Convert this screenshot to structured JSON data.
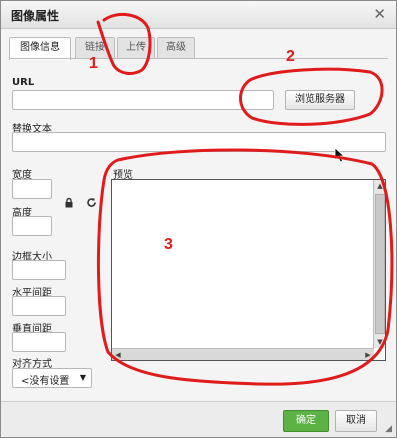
{
  "dialog": {
    "title": "图像属性",
    "close_icon": "close-icon"
  },
  "tabs": [
    {
      "label": "图像信息",
      "active": true
    },
    {
      "label": "链接",
      "active": false
    },
    {
      "label": "上传",
      "active": false
    },
    {
      "label": "高级",
      "active": false
    }
  ],
  "form": {
    "url_label": "URL",
    "url_value": "",
    "browse_button": "浏览服务器",
    "alt_label": "替换文本",
    "alt_value": "",
    "width_label": "宽度",
    "width_value": "",
    "height_label": "高度",
    "height_value": "",
    "lock_icon": "lock-icon",
    "reset_icon": "reset-size-icon",
    "border_label": "边框大小",
    "border_value": "",
    "hspace_label": "水平间距",
    "hspace_value": "",
    "vspace_label": "垂直间距",
    "vspace_value": "",
    "align_label": "对齐方式",
    "align_selected": "<没有设置"
  },
  "preview": {
    "label": "预览"
  },
  "footer": {
    "ok_label": "确定",
    "cancel_label": "取消"
  },
  "annotations": {
    "color": "#e01b1b",
    "labels": [
      "1",
      "2",
      "3"
    ]
  }
}
